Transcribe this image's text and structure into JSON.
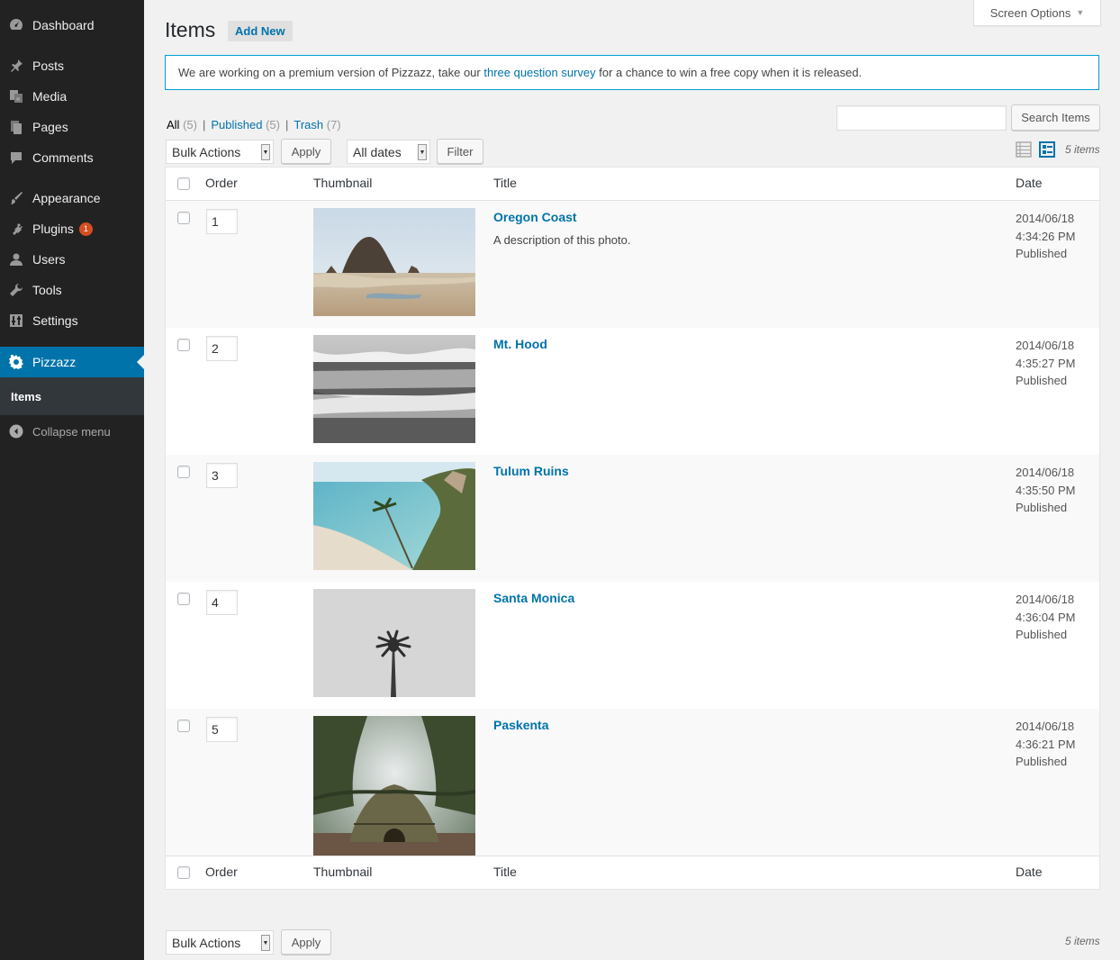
{
  "sidebar": {
    "items": [
      {
        "label": "Dashboard",
        "icon": "dashboard-icon"
      },
      {
        "label": "Posts",
        "icon": "pin-icon"
      },
      {
        "label": "Media",
        "icon": "media-icon"
      },
      {
        "label": "Pages",
        "icon": "pages-icon"
      },
      {
        "label": "Comments",
        "icon": "comment-icon"
      },
      {
        "label": "Appearance",
        "icon": "brush-icon"
      },
      {
        "label": "Plugins",
        "icon": "plug-icon",
        "badge": "1"
      },
      {
        "label": "Users",
        "icon": "user-icon"
      },
      {
        "label": "Tools",
        "icon": "wrench-icon"
      },
      {
        "label": "Settings",
        "icon": "settings-icon"
      },
      {
        "label": "Pizzazz",
        "icon": "gear-icon",
        "active": true
      }
    ],
    "submenu": {
      "label": "Items"
    },
    "collapse_label": "Collapse menu"
  },
  "header": {
    "title": "Items",
    "add_new_label": "Add New",
    "screen_options_label": "Screen Options"
  },
  "notice": {
    "text_before": "We are working on a premium version of Pizzazz, take our ",
    "link_text": "three question survey",
    "text_after": " for a chance to win a free copy when it is released."
  },
  "views": {
    "all_label": "All",
    "all_count": "(5)",
    "published_label": "Published",
    "published_count": "(5)",
    "trash_label": "Trash",
    "trash_count": "(7)",
    "separator": "|"
  },
  "search": {
    "button_label": "Search Items",
    "value": ""
  },
  "tablenav_top": {
    "bulk_actions": "Bulk Actions",
    "apply_label": "Apply",
    "dates_filter": "All dates",
    "filter_label": "Filter",
    "items_count": "5 items"
  },
  "tablenav_bottom": {
    "bulk_actions": "Bulk Actions",
    "apply_label": "Apply",
    "items_count": "5 items"
  },
  "table": {
    "columns": {
      "order": "Order",
      "thumbnail": "Thumbnail",
      "title": "Title",
      "date": "Date"
    },
    "rows": [
      {
        "order": "1",
        "title": "Oregon Coast",
        "description": "A description of this photo.",
        "date": "2014/06/18",
        "time": "4:34:26 PM",
        "status": "Published"
      },
      {
        "order": "2",
        "title": "Mt. Hood",
        "description": "",
        "date": "2014/06/18",
        "time": "4:35:27 PM",
        "status": "Published"
      },
      {
        "order": "3",
        "title": "Tulum Ruins",
        "description": "",
        "date": "2014/06/18",
        "time": "4:35:50 PM",
        "status": "Published"
      },
      {
        "order": "4",
        "title": "Santa Monica",
        "description": "",
        "date": "2014/06/18",
        "time": "4:36:04 PM",
        "status": "Published"
      },
      {
        "order": "5",
        "title": "Paskenta",
        "description": "",
        "date": "2014/06/18",
        "time": "4:36:21 PM",
        "status": "Published"
      }
    ]
  },
  "colors": {
    "sidebar_bg": "#222222",
    "active_bg": "#0073aa",
    "link": "#0073aa",
    "notice_border": "#00a0d2",
    "badge": "#d54e21"
  }
}
